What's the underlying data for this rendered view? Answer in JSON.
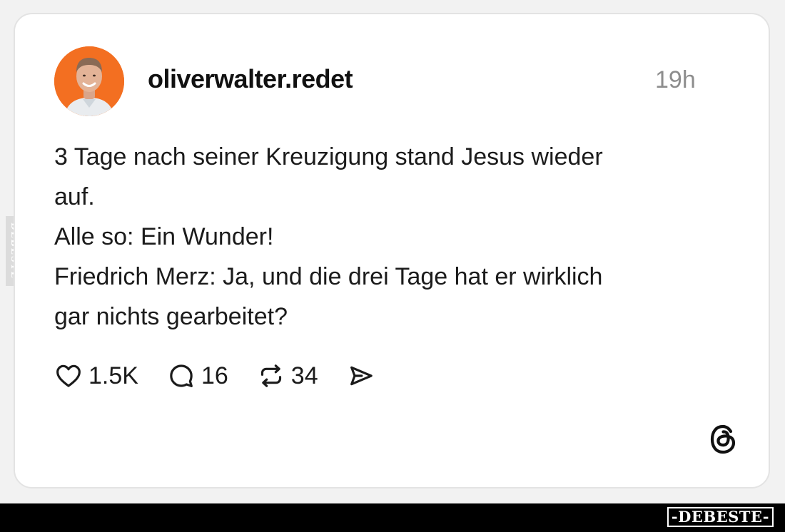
{
  "post": {
    "username": "oliverwalter.redet",
    "timestamp": "19h",
    "text_lines": [
      "3 Tage nach seiner Kreuzigung stand Jesus wieder",
      "auf.",
      "Alle so: Ein Wunder!",
      "Friedrich Merz: Ja, und die drei Tage hat er wirklich",
      "gar nichts gearbeitet?"
    ],
    "actions": {
      "likes": "1.5K",
      "comments": "16",
      "reposts": "34"
    },
    "icons": {
      "like": "heart-icon",
      "comment": "comment-bubble-icon",
      "repost": "repost-arrows-icon",
      "share": "send-icon",
      "platform": "threads-logo-icon"
    },
    "avatar_color": "#f36f21"
  },
  "watermarks": {
    "side": "DEBESTE",
    "bottom": "-DEBESTE-"
  }
}
